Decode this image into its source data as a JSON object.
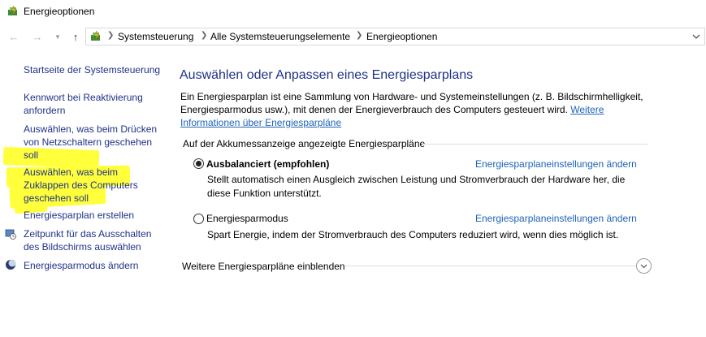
{
  "window": {
    "title": "Energieoptionen"
  },
  "breadcrumb": [
    "Systemsteuerung",
    "Alle Systemsteuerungselemente",
    "Energieoptionen"
  ],
  "sidebar": {
    "items": [
      {
        "lines": [
          "Startseite der Systemsteuerung"
        ]
      },
      {
        "lines": [
          "Kennwort bei Reaktivierung",
          "anfordern"
        ]
      },
      {
        "lines": [
          "Auswählen, was beim Drücken",
          "von Netzschaltern geschehen",
          "soll"
        ]
      },
      {
        "lines": [
          "Auswählen, was beim",
          "Zuklappen des Computers",
          "geschehen soll"
        ]
      },
      {
        "lines": [
          "Energiesparplan erstellen"
        ]
      },
      {
        "lines": [
          "Zeitpunkt für das Ausschalten",
          "des Bildschirms auswählen"
        ]
      },
      {
        "lines": [
          "Energiesparmodus ändern"
        ]
      }
    ]
  },
  "main": {
    "title": "Auswählen oder Anpassen eines Energiesparplans",
    "description": "Ein Energiesparplan ist eine Sammlung von Hardware- und Systemeinstellungen (z. B. Bildschirmhelligkeit, Energiesparmodus usw.), mit denen der Energieverbrauch des Computers gesteuert wird. ",
    "description_link": "Weitere Informationen über Energiesparpläne",
    "group_label": "Auf der Akkumessanzeige angezeigte Energiesparpläne",
    "plans": [
      {
        "name": "Ausbalanciert (empfohlen)",
        "selected": true,
        "link": "Energiesparplaneinstellungen ändern",
        "desc_lines": [
          "Stellt automatisch einen Ausgleich zwischen Leistung und Stromverbrauch der Hardware her, die",
          "diese Funktion unterstützt."
        ]
      },
      {
        "name": "Energiesparmodus",
        "selected": false,
        "link": "Energiesparplaneinstellungen ändern",
        "desc_lines": [
          "Spart Energie, indem der Stromverbrauch des Computers reduziert wird, wenn dies möglich ist."
        ]
      }
    ],
    "more_label": "Weitere Energiesparpläne einblenden"
  },
  "colors": {
    "link": "#1e3287",
    "accent_link": "#1e64b4",
    "highlight": "#ffff3c"
  }
}
